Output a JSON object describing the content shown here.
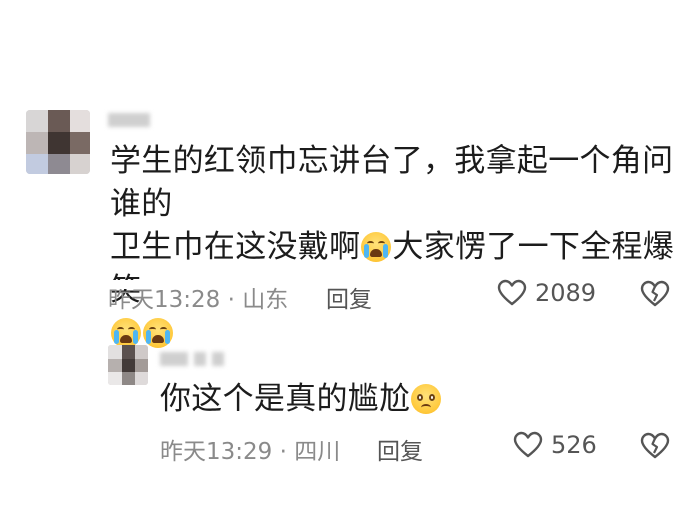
{
  "comments": [
    {
      "text_line1": "学生的红领巾忘讲台了，我拿起一个角问谁的",
      "text_line2a": "卫生巾在这没戴啊",
      "text_line2b": "大家愣了一下全程爆笑",
      "emoji_line2": "loudly-crying-face",
      "emoji_line3": [
        "loudly-crying-face",
        "loudly-crying-face"
      ],
      "time": "昨天13:28",
      "separator": "·",
      "location": "山东",
      "reply_label": "回复",
      "likes": "2089"
    },
    {
      "text": "你这个是真的尴尬",
      "emoji": "pleading-face",
      "time": "昨天13:29",
      "separator": "·",
      "location": "四川",
      "reply_label": "回复",
      "likes": "526"
    }
  ]
}
